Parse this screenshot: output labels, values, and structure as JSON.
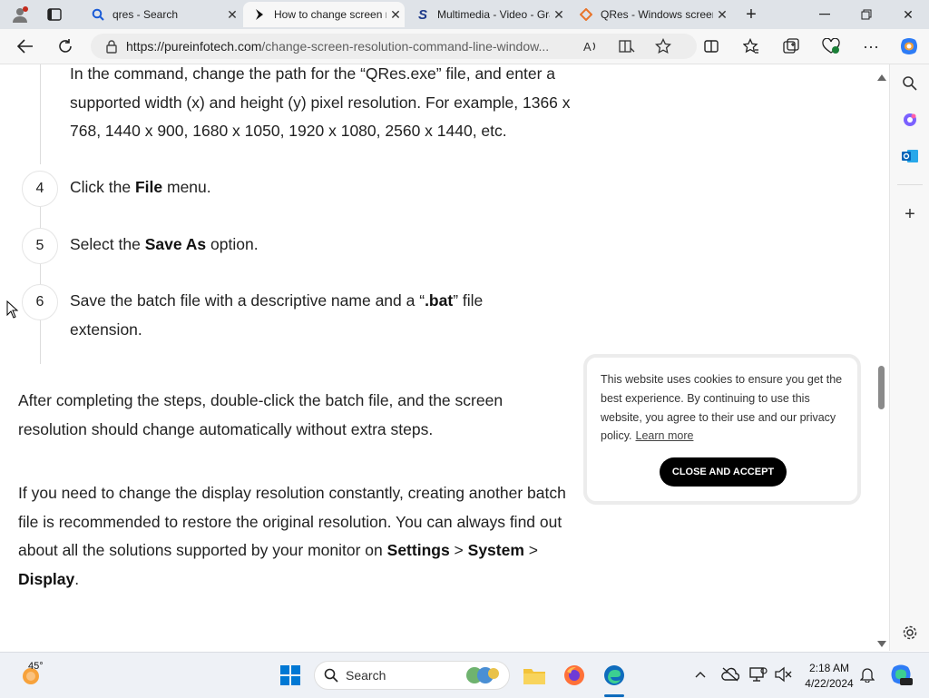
{
  "browser": {
    "tabs": [
      {
        "title": "qres - Search",
        "icon": "search-icon",
        "active": false
      },
      {
        "title": "How to change screen resolution",
        "icon": "pureinfotech-icon",
        "active": true
      },
      {
        "title": "Multimedia - Video - Graphics",
        "icon": "softpedia-icon",
        "active": false
      },
      {
        "title": "QRes - Windows screen resolution",
        "icon": "qres-icon",
        "active": false
      }
    ],
    "url_host": "https://pureinfotech.com",
    "url_path": "/change-screen-resolution-command-line-window..."
  },
  "article": {
    "step3_text": "In the command, change the path for the “QRes.exe” file, and enter a supported width (x) and height (y) pixel resolution. For example, 1366 x 768, 1440 x 900, 1680 x 1050, 1920 x 1080, 2560 x 1440, etc.",
    "steps": [
      {
        "num": "4",
        "before": "Click the ",
        "bold": "File",
        "after": " menu."
      },
      {
        "num": "5",
        "before": "Select the ",
        "bold": "Save As",
        "after": " option."
      },
      {
        "num": "6",
        "before": "Save the batch file with a descriptive name and a “",
        "bold": ".bat",
        "after": "” file extension."
      }
    ],
    "para1": "After completing the steps, double-click the batch file, and the screen resolution should change automatically without extra steps.",
    "para2_lead": "If you need to change the display resolution constantly, creating another batch file is recommended to restore the original resolution. You can always find out about all the solutions supported by your monitor on ",
    "para2_settings": "Settings",
    "para2_sep1": " > ",
    "para2_system": "System",
    "para2_sep2": " > ",
    "para2_display": "Display",
    "para2_end": "."
  },
  "cookie": {
    "text": "This website uses cookies to ensure you get the best experience. By continuing to use this website, you agree to their use and our privacy policy.",
    "link": "Learn more",
    "button": "CLOSE AND ACCEPT"
  },
  "taskbar": {
    "weather_temp": "45°",
    "search_label": "Search",
    "time": "2:18 AM",
    "date": "4/22/2024"
  },
  "colors": {
    "edge_accent": "#0f6cbd",
    "windows_blue": "#0078d4"
  }
}
